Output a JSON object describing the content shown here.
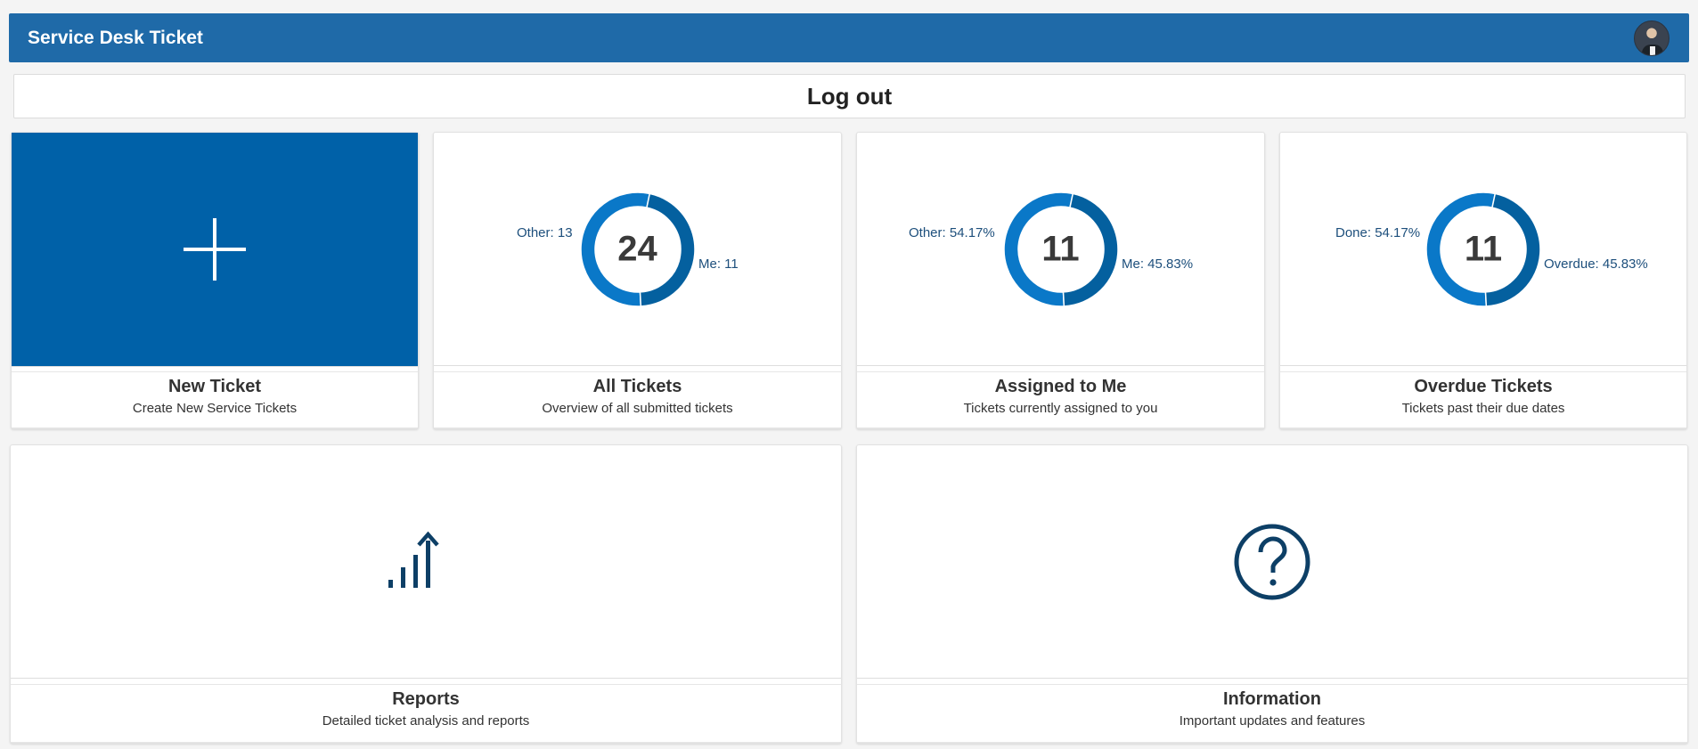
{
  "header": {
    "title": "Service Desk Ticket"
  },
  "logout": {
    "label": "Log out"
  },
  "tiles": {
    "new_ticket": {
      "title": "New Ticket",
      "subtitle": "Create New Service Tickets"
    },
    "all_tickets": {
      "title": "All Tickets",
      "subtitle": "Overview of all submitted tickets",
      "center": "24",
      "left_label": "Other: 13",
      "right_label": "Me: 11",
      "segments": [
        13,
        11
      ]
    },
    "assigned": {
      "title": "Assigned to Me",
      "subtitle": "Tickets currently assigned to you",
      "center": "11",
      "left_label": "Other: 54.17%",
      "right_label": "Me: 45.83%",
      "segments": [
        54.17,
        45.83
      ]
    },
    "overdue": {
      "title": "Overdue Tickets",
      "subtitle": "Tickets past their due dates",
      "center": "11",
      "left_label": "Done: 54.17%",
      "right_label": "Overdue: 45.83%",
      "segments": [
        54.17,
        45.83
      ]
    },
    "reports": {
      "title": "Reports",
      "subtitle": "Detailed ticket analysis and reports"
    },
    "information": {
      "title": "Information",
      "subtitle": "Important updates and features"
    }
  },
  "icons": {
    "new_ticket": "plus-icon",
    "reports": "bar-chart-arrow-icon",
    "information": "question-circle-icon",
    "avatar": "user-avatar"
  },
  "colors": {
    "header": "#1f6aa8",
    "new_ticket_bg": "#0061a8",
    "donut_a": "#0a78c8",
    "donut_b": "#04609f",
    "icon": "#0d3f66"
  }
}
